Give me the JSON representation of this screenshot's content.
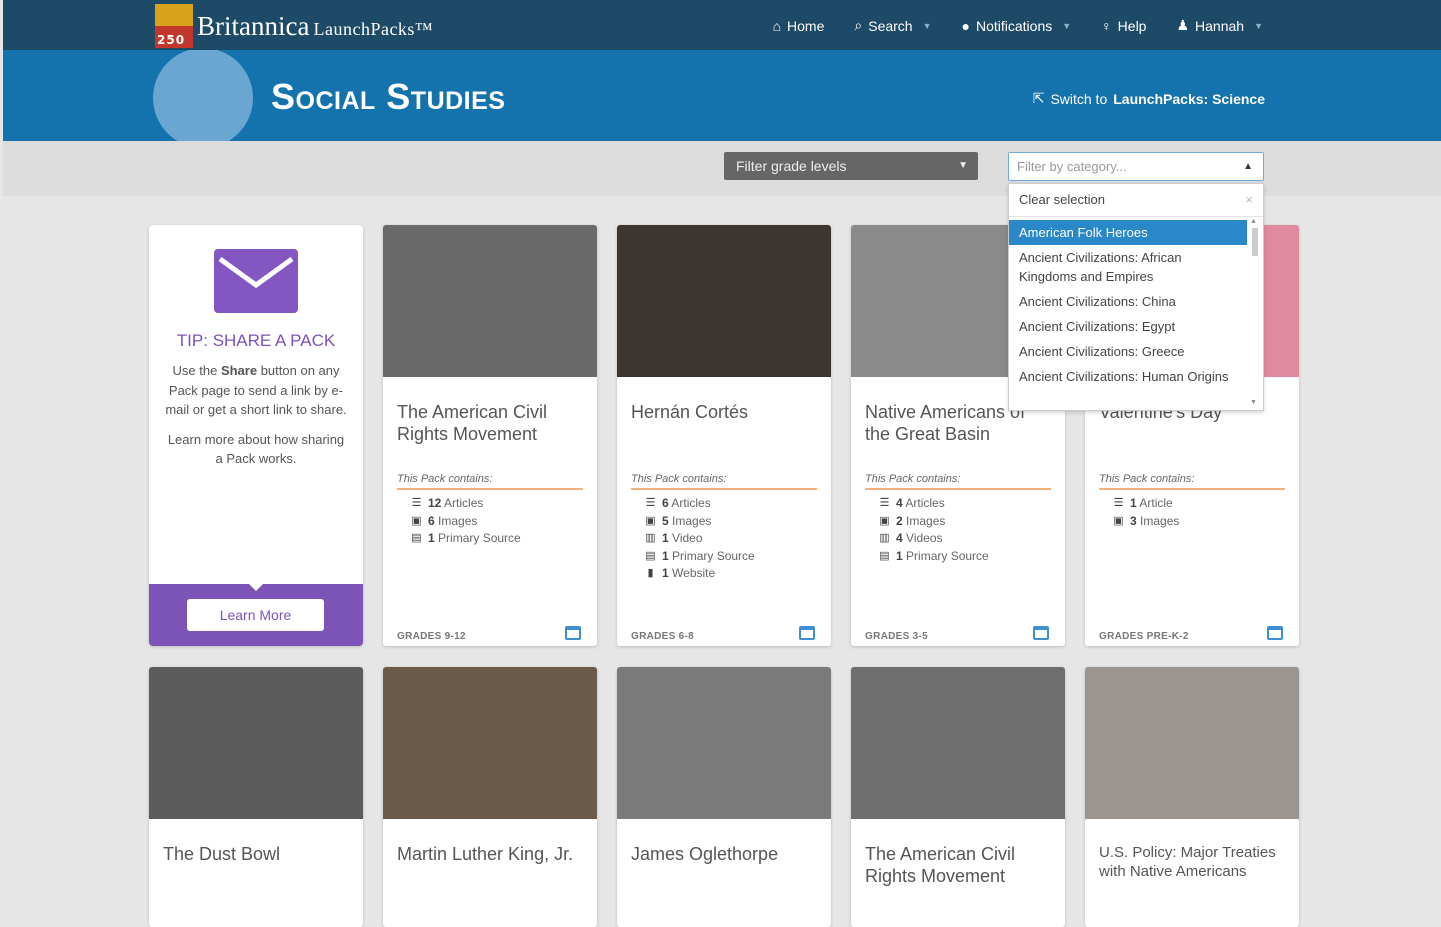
{
  "brand": {
    "badge": "250",
    "name": "Britannica",
    "product": "LaunchPacks™"
  },
  "nav": [
    {
      "label": "Home",
      "icon": "home-icon",
      "dropdown": false
    },
    {
      "label": "Search",
      "icon": "search-icon",
      "dropdown": true
    },
    {
      "label": "Notifications",
      "icon": "chat-bubble-icon",
      "dropdown": true
    },
    {
      "label": "Help",
      "icon": "lightbulb-icon",
      "dropdown": false
    },
    {
      "label": "Hannah",
      "icon": "user-icon",
      "dropdown": true
    }
  ],
  "hero": {
    "title": "Social Studies",
    "switch_prefix": "Switch to",
    "switch_target": "LaunchPacks: Science"
  },
  "filters": {
    "grade_placeholder": "Filter grade levels",
    "category_placeholder": "Filter by category...",
    "clear_label": "Clear selection",
    "options": [
      "American Folk Heroes",
      "Ancient Civilizations: African Kingdoms and Empires",
      "Ancient Civilizations: China",
      "Ancient Civilizations: Egypt",
      "Ancient Civilizations: Greece",
      "Ancient Civilizations: Human Origins"
    ],
    "active_index": 0
  },
  "tip": {
    "title": "TIP: SHARE A PACK",
    "text1_a": "Use the",
    "text1_b": "Share",
    "text1_c": "button on any Pack page to send a link by e-mail or get a short link to share.",
    "text2": "Learn more about how sharing a Pack works.",
    "button": "Learn More"
  },
  "contains_label": "This Pack contains:",
  "cards": [
    {
      "title": "The American Civil Rights Movement",
      "grades": "GRADES 9-12",
      "tone": "#6a6a6a",
      "items": [
        {
          "icon": "list-icon",
          "count": "12",
          "label": "Articles"
        },
        {
          "icon": "image-icon",
          "count": "6",
          "label": "Images"
        },
        {
          "icon": "document-icon",
          "count": "1",
          "label": "Primary Source"
        }
      ]
    },
    {
      "title": "Hernán Cortés",
      "grades": "GRADES 6-8",
      "tone": "#3c3530",
      "items": [
        {
          "icon": "list-icon",
          "count": "6",
          "label": "Articles"
        },
        {
          "icon": "image-icon",
          "count": "5",
          "label": "Images"
        },
        {
          "icon": "film-icon",
          "count": "1",
          "label": "Video"
        },
        {
          "icon": "document-icon",
          "count": "1",
          "label": "Primary Source"
        },
        {
          "icon": "bookmark-icon",
          "count": "1",
          "label": "Website"
        }
      ]
    },
    {
      "title": "Native Americans of the Great Basin",
      "grades": "GRADES 3-5",
      "tone": "#8a8a8a",
      "items": [
        {
          "icon": "list-icon",
          "count": "4",
          "label": "Articles"
        },
        {
          "icon": "image-icon",
          "count": "2",
          "label": "Images"
        },
        {
          "icon": "film-icon",
          "count": "4",
          "label": "Videos"
        },
        {
          "icon": "document-icon",
          "count": "1",
          "label": "Primary Source"
        }
      ]
    },
    {
      "title": "Valentine's Day",
      "grades": "GRADES PRE-K-2",
      "tone": "#e08aa0",
      "items": [
        {
          "icon": "list-icon",
          "count": "1",
          "label": "Article"
        },
        {
          "icon": "image-icon",
          "count": "3",
          "label": "Images"
        }
      ]
    }
  ],
  "cards_row2": [
    {
      "title": "The Dust Bowl",
      "tone": "#5c5c5c"
    },
    {
      "title": "Martin Luther King, Jr.",
      "tone": "#6b5a4a"
    },
    {
      "title": "James Oglethorpe",
      "tone": "#7a7a7a"
    },
    {
      "title": "The American Civil Rights Movement",
      "tone": "#6e6e6e"
    },
    {
      "title": "U.S. Policy: Major Treaties with Native Americans",
      "tone": "#9a9590"
    }
  ]
}
